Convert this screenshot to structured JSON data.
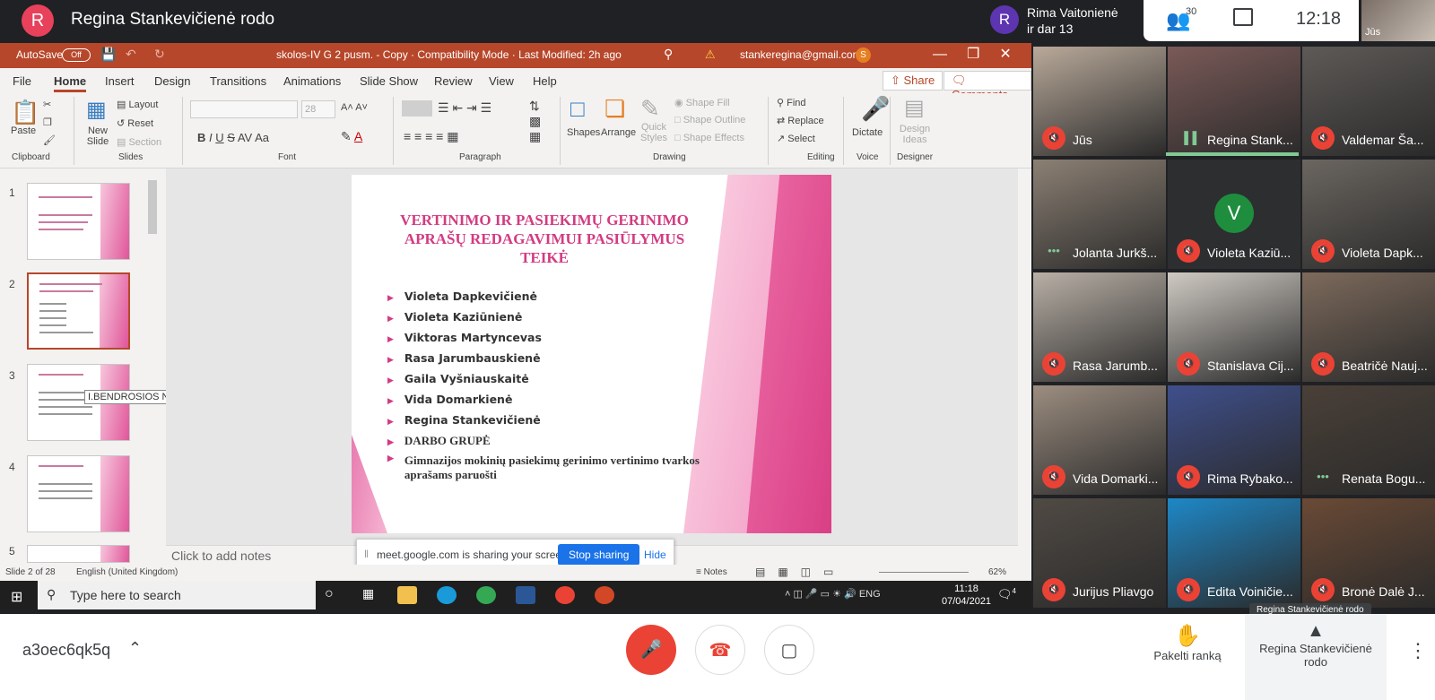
{
  "presenter": {
    "initial": "R",
    "title": "Regina Stankevičienė rodo"
  },
  "speaker": {
    "initial": "R",
    "line1": "Rima Vaitonienė",
    "line2": "ir dar 13"
  },
  "topbar": {
    "people_count": "30",
    "time": "12:18",
    "self_label": "Jūs"
  },
  "ppt": {
    "autosave_label": "AutoSave",
    "autosave_state": "Off",
    "doc_title": "skolos-IV G 2 pusm. - Copy  ·  Compatibility Mode  ·  Last Modified: 2h ago",
    "account": "stankeregina@gmail.com",
    "account_initial": "S",
    "tabs": [
      "File",
      "Home",
      "Insert",
      "Design",
      "Transitions",
      "Animations",
      "Slide Show",
      "Review",
      "View",
      "Help"
    ],
    "share_label": "Share",
    "comments_label": "Comments",
    "ribbon": {
      "paste": "Paste",
      "new_slide": "New Slide",
      "layout": "Layout",
      "reset": "Reset",
      "section": "Section",
      "font_size": "28",
      "shapes": "Shapes",
      "arrange": "Arrange",
      "quick_styles": "Quick Styles",
      "shape_fill": "Shape Fill",
      "shape_outline": "Shape Outline",
      "shape_effects": "Shape Effects",
      "find": "Find",
      "replace": "Replace",
      "select": "Select",
      "dictate": "Dictate",
      "design_ideas": "Design Ideas",
      "groups": [
        "Clipboard",
        "Slides",
        "Font",
        "Paragraph",
        "Drawing",
        "Editing",
        "Voice",
        "Designer"
      ]
    },
    "slide_numbers": [
      "1",
      "2",
      "3",
      "4",
      "5"
    ],
    "tooltip": "I.BENDROSIOS NUOSTATOS",
    "slide": {
      "title": "VERTINIMO IR PASIEKIMŲ GERINIMO APRAŠŲ REDAGAVIMUI PASIŪLYMUS TEIKĖ",
      "bullets": [
        "Violeta Dapkevičienė",
        "Violeta Kaziūnienė",
        "Viktoras Martyncevas",
        "Rasa Jarumbauskienė",
        "Gaila Vyšniauskaitė",
        "Vida Domarkienė",
        "Regina Stankevičienė"
      ],
      "bullet_group": "DARBO GRUPĖ",
      "bullet_last": "Gimnazijos mokinių pasiekimų gerinimo vertinimo tvarkos aprašams  paruošti"
    },
    "notes_placeholder": "Click to add notes",
    "status": {
      "slide": "Slide 2 of 28",
      "lang": "English (United Kingdom)",
      "notes": "Notes",
      "zoom": "62%"
    }
  },
  "share_banner": {
    "text": "meet.google.com is sharing your screen.",
    "stop": "Stop sharing",
    "hide": "Hide"
  },
  "taskbar": {
    "search": "Type here to search",
    "lang": "ENG",
    "time": "11:18",
    "date": "07/04/2021",
    "notif": "4"
  },
  "participants": [
    {
      "name": "Jūs",
      "mic": "muted",
      "bg": "#b9a99a"
    },
    {
      "name": "Regina Stank...",
      "mic": "speaking",
      "bg": "#7a5a58"
    },
    {
      "name": "Valdemar Ša...",
      "mic": "muted",
      "bg": "#5e5a57"
    },
    {
      "name": "Jolanta Jurkš...",
      "mic": "dots",
      "bg": "#8c8074"
    },
    {
      "name": "Violeta Kaziū...",
      "mic": "muted",
      "bg": "#2d2e30",
      "avatar": "V"
    },
    {
      "name": "Violeta Dapk...",
      "mic": "muted",
      "bg": "#6b6660"
    },
    {
      "name": "Rasa Jarumb...",
      "mic": "muted",
      "bg": "#b9b0a6"
    },
    {
      "name": "Stanislava Cij...",
      "mic": "muted",
      "bg": "#cfcac3"
    },
    {
      "name": "Beatričė Nauj...",
      "mic": "muted",
      "bg": "#7d6a5c"
    },
    {
      "name": "Vida Domarki...",
      "mic": "muted",
      "bg": "#9c8d80"
    },
    {
      "name": "Rima Rybako...",
      "mic": "muted",
      "bg": "#3f4f8c"
    },
    {
      "name": "Renata Bogu...",
      "mic": "dots",
      "bg": "#4a4038"
    },
    {
      "name": "Jurijus Pliavgo",
      "mic": "muted",
      "bg": "#504a44"
    },
    {
      "name": "Edita Voiničie...",
      "mic": "muted",
      "bg": "#1e88c7"
    },
    {
      "name": "Bronė Dalė J...",
      "mic": "muted",
      "bg": "#6a4a36"
    }
  ],
  "hover_label": "Regina Stankevičienė rodo",
  "bottom": {
    "meeting_code": "a3oec6qk5q",
    "raise_hand": "Pakelti ranką",
    "present_line1": "Regina Stankevičienė",
    "present_line2": "rodo"
  },
  "colors": {
    "ppt_accent": "#b7472a",
    "mute_red": "#ea4335",
    "slide_pink": "#d33b82",
    "meet_blue": "#1a73e8"
  }
}
